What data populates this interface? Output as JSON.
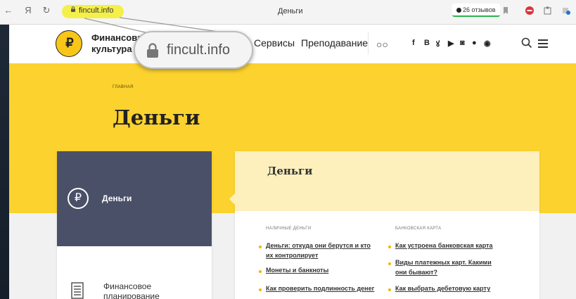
{
  "browser": {
    "back_icon": "←",
    "yandex_icon": "Я",
    "reload_icon": "↻",
    "url": "fincult.info",
    "tab_title": "Деньги",
    "reviews": "26 отзывов"
  },
  "header": {
    "logo_symbol": "₽",
    "logo_line1": "Финансовая",
    "logo_line2": "культура",
    "nav": [
      "Сервисы",
      "Преподавание"
    ],
    "glasses": "○○",
    "social": [
      "f",
      "B",
      "ꙋ",
      "▶",
      "◙",
      "●",
      "◉"
    ]
  },
  "magnifier": {
    "url": "fincult.info"
  },
  "hero": {
    "breadcrumb": "ГЛАВНАЯ",
    "title": "Деньги"
  },
  "menu": {
    "active_symbol": "₽",
    "active_label": "Деньги",
    "item_line1": "Финансовое",
    "item_line2": "планирование"
  },
  "content": {
    "title": "Деньги",
    "col1_head": "НАЛИЧНЫЕ ДЕНЬГИ",
    "col2_head": "БАНКОВСКАЯ КАРТА",
    "col1_links": [
      {
        "line1": "Деньги: откуда они берутся и кто",
        "line2": "их контролирует"
      },
      {
        "line1": "Монеты и банкноты",
        "line2": ""
      },
      {
        "line1": "Как проверить подлинность денег",
        "line2": ""
      }
    ],
    "col2_links": [
      {
        "line1": "Как устроена банковская карта",
        "line2": ""
      },
      {
        "line1": "Виды платежных карт. Какими",
        "line2": "они бывают?"
      },
      {
        "line1": "Как выбрать дебетовую карту",
        "line2": ""
      }
    ]
  },
  "colors": {
    "accent_yellow": "#fcd22f",
    "menu_active": "#4a5068",
    "bullet": "#f4b400",
    "url_highlight": "#f5ef4a"
  }
}
